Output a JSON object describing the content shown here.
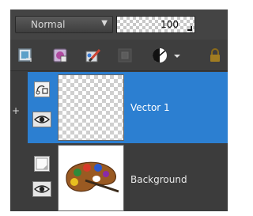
{
  "blend": {
    "mode_label": "Normal",
    "dropdown_icon": "chevron-down-icon",
    "opacity_value": "100"
  },
  "toolbar": {
    "tools": [
      {
        "name": "new-layer-icon"
      },
      {
        "name": "layer-mask-icon"
      },
      {
        "name": "brush-layer-icon"
      },
      {
        "name": "group-layer-icon"
      },
      {
        "name": "adjustment-layer-icon"
      },
      {
        "name": "chevron-down-icon"
      },
      {
        "name": "lock-icon"
      }
    ]
  },
  "layers": [
    {
      "name": "Vector 1",
      "type_icon": "vector-layer-icon",
      "visible": true,
      "selected": true
    },
    {
      "name": "Background",
      "type_icon": "raster-layer-icon",
      "visible": true,
      "selected": false
    }
  ],
  "colors": {
    "panel_bg": "#3c3c3c",
    "selection": "#2c7fd1"
  }
}
